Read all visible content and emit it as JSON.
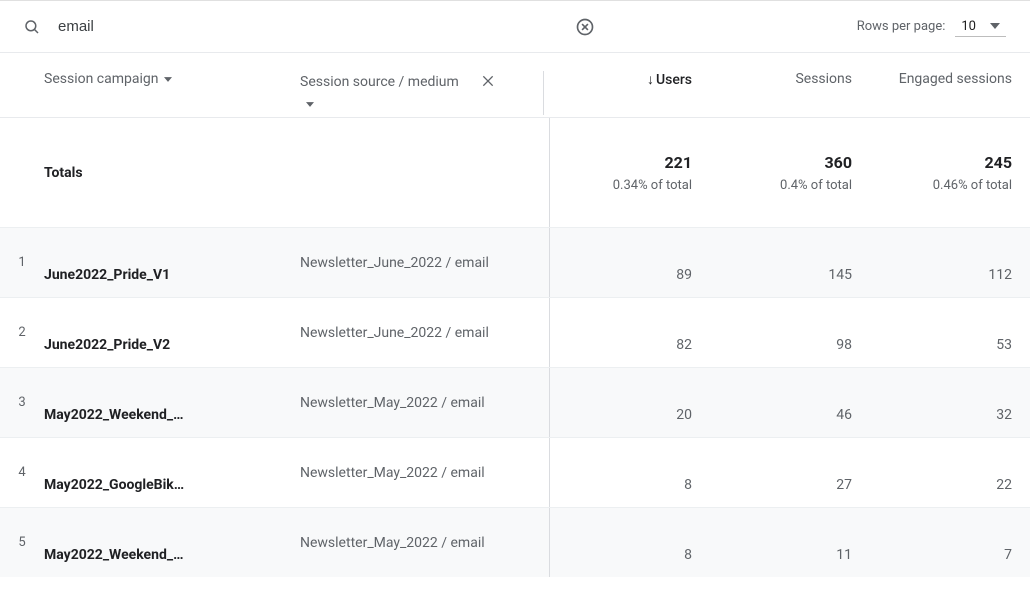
{
  "search": {
    "value": "email"
  },
  "rowsPerPage": {
    "label": "Rows per page:",
    "value": "10"
  },
  "dimensions": {
    "primary": "Session campaign",
    "secondary": "Session source / medium"
  },
  "metrics": [
    {
      "label": "Users",
      "sorted": true
    },
    {
      "label": "Sessions",
      "sorted": false
    },
    {
      "label": "Engaged sessions",
      "sorted": false
    }
  ],
  "totals": {
    "label": "Totals",
    "values": [
      "221",
      "360",
      "245"
    ],
    "pct": [
      "0.34% of total",
      "0.4% of total",
      "0.46% of total"
    ]
  },
  "rows": [
    {
      "idx": "1",
      "campaign": "June2022_Pride_V1",
      "source": "Newsletter_June_2022 / email",
      "values": [
        "89",
        "145",
        "112"
      ]
    },
    {
      "idx": "2",
      "campaign": "June2022_Pride_V2",
      "source": "Newsletter_June_2022 / email",
      "values": [
        "82",
        "98",
        "53"
      ]
    },
    {
      "idx": "3",
      "campaign": "May2022_Weekend_…",
      "source": "Newsletter_May_2022 / email",
      "values": [
        "20",
        "46",
        "32"
      ]
    },
    {
      "idx": "4",
      "campaign": "May2022_GoogleBik…",
      "source": "Newsletter_May_2022 / email",
      "values": [
        "8",
        "27",
        "22"
      ]
    },
    {
      "idx": "5",
      "campaign": "May2022_Weekend_…",
      "source": "Newsletter_May_2022 / email",
      "values": [
        "8",
        "11",
        "7"
      ]
    }
  ]
}
